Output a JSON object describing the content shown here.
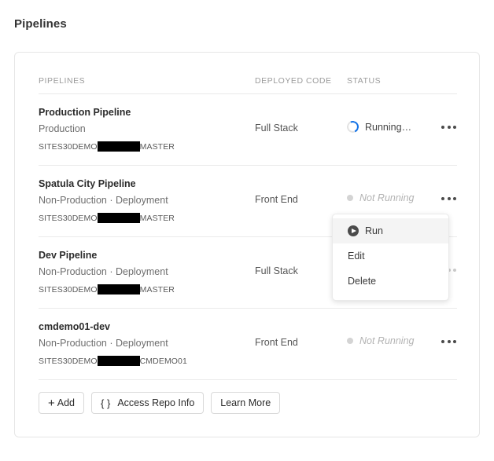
{
  "page": {
    "title": "Pipelines"
  },
  "table": {
    "headers": {
      "pipelines": "PIPELINES",
      "deployed_code": "DEPLOYED CODE",
      "status": "STATUS"
    },
    "rows": [
      {
        "name": "Production Pipeline",
        "meta": "Production",
        "repo_prefix": "SITES30DEMO",
        "repo_suffix": "MASTER",
        "deployed_code": "Full Stack",
        "status": "Running…",
        "status_type": "running",
        "menu_icon": "kebab-icon"
      },
      {
        "name": "Spatula City Pipeline",
        "meta": "Non-Production  ·  Deployment",
        "repo_prefix": "SITES30DEMO",
        "repo_suffix": "MASTER",
        "deployed_code": "Front End",
        "status": "Not Running",
        "status_type": "idle",
        "menu_icon": "kebab-icon"
      },
      {
        "name": "Dev Pipeline",
        "meta": "Non-Production  ·  Deployment",
        "repo_prefix": "SITES30DEMO",
        "repo_suffix": "MASTER",
        "deployed_code": "Full Stack",
        "status": "",
        "status_type": "hidden",
        "menu_icon": "kebab-icon"
      },
      {
        "name": "cmdemo01-dev",
        "meta": "Non-Production  ·  Deployment",
        "repo_prefix": "SITES30DEMO",
        "repo_suffix": "CMDEMO01",
        "deployed_code": "Front End",
        "status": "Not Running",
        "status_type": "idle",
        "menu_icon": "kebab-icon"
      }
    ]
  },
  "footer": {
    "add_label": "Add",
    "add_glyph": "+",
    "access_repo_label": "Access Repo Info",
    "access_repo_glyph": "{ }",
    "learn_more_label": "Learn More"
  },
  "context_menu": {
    "items": [
      {
        "label": "Run",
        "icon": "play-circle-icon",
        "active": true
      },
      {
        "label": "Edit",
        "icon": "",
        "active": false
      },
      {
        "label": "Delete",
        "icon": "",
        "active": false
      }
    ]
  },
  "colors": {
    "accent_blue": "#1473e6",
    "text_primary": "#2b2b2b",
    "text_muted": "#9b9b9b",
    "border": "#e6e6e6"
  }
}
